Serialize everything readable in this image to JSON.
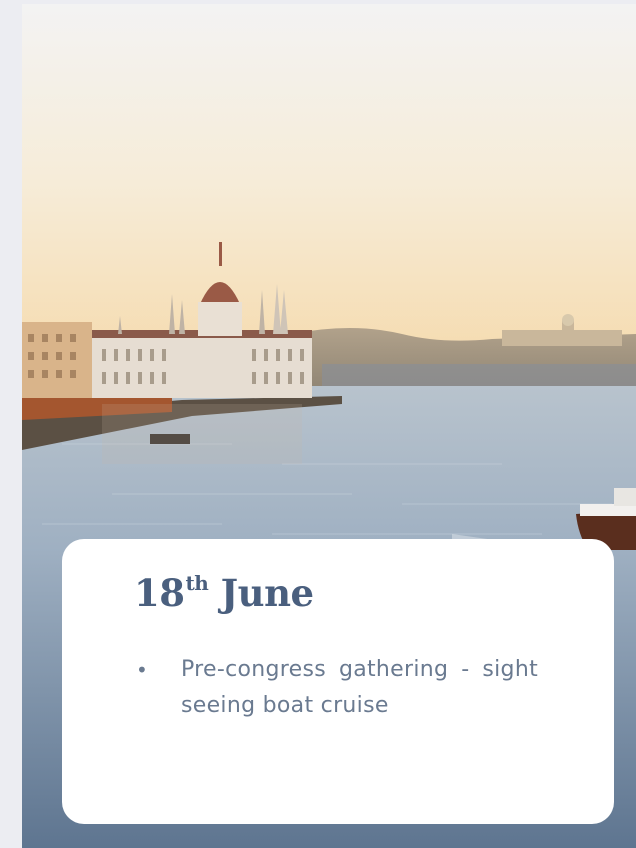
{
  "photo": {
    "subject": "parliament-river-scene",
    "sky_top": "#f2f2f0",
    "sky_bottom": "#f6d9a8",
    "water": "#8fa6bd"
  },
  "event": {
    "day": "18",
    "suffix": "th",
    "month": "June",
    "items": [
      {
        "text": "Pre-congress gathering - sight seeing boat cruise"
      }
    ]
  },
  "colors": {
    "heading": "#4a5f7e",
    "body_text": "#6a7a90",
    "card": "#ffffff",
    "page_bg": "#ecedf2"
  }
}
